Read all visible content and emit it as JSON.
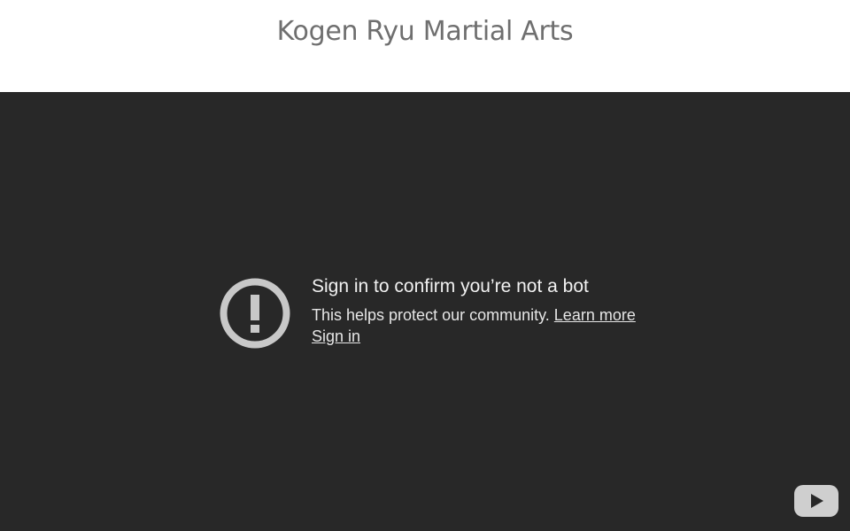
{
  "header": {
    "site_title": "Kogen Ryu Martial Arts"
  },
  "video_error": {
    "icon": "exclamation-circle-icon",
    "heading": "Sign in to confirm you’re not a bot",
    "body_text": "This helps protect our community.",
    "learn_more_label": "Learn more",
    "sign_in_label": "Sign in"
  },
  "player": {
    "logo_icon": "youtube-logo-icon"
  },
  "colors": {
    "header_bg": "#ffffff",
    "title_color": "#6f6f6f",
    "player_bg": "#282828",
    "icon_color": "#c8c8c8",
    "text_color": "#f1f1f1"
  }
}
